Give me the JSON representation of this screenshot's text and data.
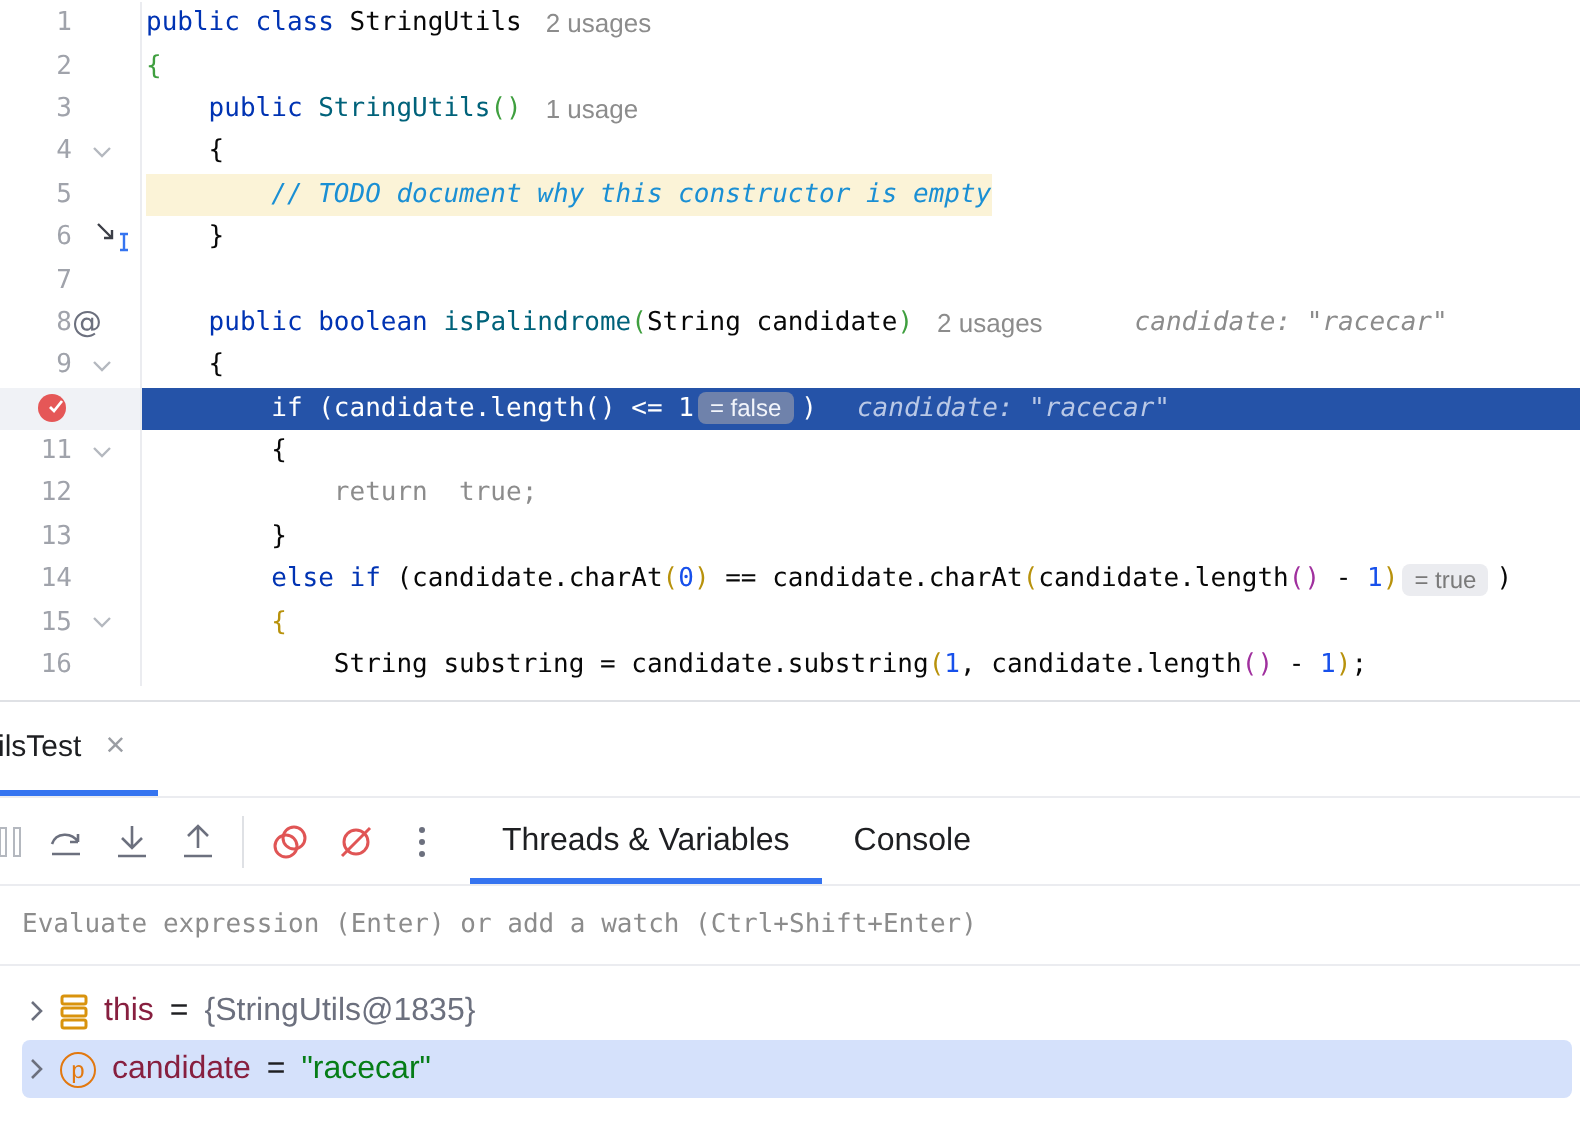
{
  "editor": {
    "lines": [
      {
        "number": "1",
        "foldable": false,
        "current": false,
        "breakpoint": false,
        "step_cursor": false,
        "tokens": [
          {
            "kind": "keyword",
            "text": "public class "
          },
          {
            "kind": "plain",
            "text": "StringUtils"
          },
          {
            "kind": "hint",
            "text": "2 usages"
          }
        ]
      },
      {
        "number": "2",
        "foldable": false,
        "current": false,
        "breakpoint": false,
        "step_cursor": false,
        "tokens": [
          {
            "kind": "green",
            "text": "{"
          }
        ]
      },
      {
        "number": "3",
        "foldable": false,
        "current": false,
        "breakpoint": false,
        "step_cursor": false,
        "tokens": [
          {
            "kind": "keyword",
            "text": "    public "
          },
          {
            "kind": "method",
            "text": "StringUtils"
          },
          {
            "kind": "green",
            "text": "()"
          },
          {
            "kind": "hint",
            "text": "1 usage"
          }
        ]
      },
      {
        "number": "4",
        "foldable": true,
        "current": false,
        "breakpoint": false,
        "step_cursor": false,
        "tokens": [
          {
            "kind": "plain",
            "text": "    {"
          }
        ]
      },
      {
        "number": "5",
        "foldable": false,
        "current": false,
        "breakpoint": false,
        "step_cursor": false,
        "tokens": [
          {
            "kind": "todo",
            "text": "        // TODO document why this constructor is empty"
          }
        ]
      },
      {
        "number": "6",
        "foldable": false,
        "current": false,
        "breakpoint": false,
        "step_cursor": true,
        "tokens": [
          {
            "kind": "plain",
            "text": "    }"
          }
        ]
      },
      {
        "number": "7",
        "foldable": false,
        "current": false,
        "breakpoint": false,
        "step_cursor": false
      },
      {
        "number": "8",
        "foldable": false,
        "current": false,
        "breakpoint": false,
        "step_cursor": false,
        "gutter_text": "@",
        "tokens": [
          {
            "kind": "keyword",
            "text": "    public boolean "
          },
          {
            "kind": "method",
            "text": "isPalindrome"
          },
          {
            "kind": "green",
            "text": "("
          },
          {
            "kind": "plain",
            "text": "String candidate"
          },
          {
            "kind": "green",
            "text": ")"
          },
          {
            "kind": "hint",
            "text": "2 usages"
          },
          {
            "kind": "inline_value",
            "text": "candidate: \"racecar\""
          }
        ]
      },
      {
        "number": "9",
        "foldable": true,
        "current": false,
        "breakpoint": false,
        "step_cursor": false,
        "tokens": [
          {
            "kind": "plain",
            "text": "    {"
          }
        ]
      },
      {
        "foldable": false,
        "current": true,
        "breakpoint": true,
        "step_cursor": false,
        "tokens": [
          {
            "kind": "keyword",
            "text": "        if "
          },
          {
            "kind": "plain",
            "text": "(candidate.length() <= "
          },
          {
            "kind": "number",
            "text": "1"
          },
          {
            "kind": "value_badge",
            "text": "= false"
          },
          {
            "kind": "plain",
            "text": ")"
          },
          {
            "kind": "inline_value",
            "text": "candidate: \"racecar\""
          }
        ]
      },
      {
        "number": "11",
        "foldable": true,
        "current": false,
        "breakpoint": false,
        "step_cursor": false,
        "tokens": [
          {
            "kind": "plain",
            "text": "        {"
          }
        ]
      },
      {
        "number": "12",
        "foldable": false,
        "current": false,
        "breakpoint": false,
        "step_cursor": false,
        "tokens": [
          {
            "kind": "muted",
            "text": "            return  true;"
          }
        ]
      },
      {
        "number": "13",
        "foldable": false,
        "current": false,
        "breakpoint": false,
        "step_cursor": false,
        "tokens": [
          {
            "kind": "plain",
            "text": "        }"
          }
        ]
      },
      {
        "number": "14",
        "foldable": false,
        "current": false,
        "breakpoint": false,
        "step_cursor": false,
        "tokens": [
          {
            "kind": "keyword",
            "text": "        else if "
          },
          {
            "kind": "plain",
            "text": "(candidate.charAt"
          },
          {
            "kind": "yellow",
            "text": "("
          },
          {
            "kind": "number",
            "text": "0"
          },
          {
            "kind": "yellow",
            "text": ")"
          },
          {
            "kind": "plain",
            "text": " == candidate.charAt"
          },
          {
            "kind": "yellow",
            "text": "("
          },
          {
            "kind": "plain",
            "text": "candidate.length"
          },
          {
            "kind": "purple",
            "text": "()"
          },
          {
            "kind": "plain",
            "text": " - "
          },
          {
            "kind": "number",
            "text": "1"
          },
          {
            "kind": "yellow",
            "text": ")"
          },
          {
            "kind": "value_badge",
            "text": "= true"
          },
          {
            "kind": "plain",
            "text": ")"
          }
        ]
      },
      {
        "number": "15",
        "foldable": true,
        "current": false,
        "breakpoint": false,
        "step_cursor": false,
        "tokens": [
          {
            "kind": "yellow",
            "text": "        {"
          }
        ]
      },
      {
        "number": "16",
        "foldable": false,
        "current": false,
        "breakpoint": false,
        "step_cursor": false,
        "tokens": [
          {
            "kind": "plain",
            "text": "            String substring = candidate.substring"
          },
          {
            "kind": "yellow",
            "text": "("
          },
          {
            "kind": "number",
            "text": "1"
          },
          {
            "kind": "plain",
            "text": ", candidate.length"
          },
          {
            "kind": "purple",
            "text": "()"
          },
          {
            "kind": "plain",
            "text": " - "
          },
          {
            "kind": "number",
            "text": "1"
          },
          {
            "kind": "yellow",
            "text": ")"
          },
          {
            "kind": "plain",
            "text": ";"
          }
        ]
      }
    ]
  },
  "session_tabs": [
    {
      "label": "ilsTest",
      "selected": true,
      "close": "×"
    }
  ],
  "debugger_tabs": [
    {
      "label": "Threads & Variables",
      "selected": true
    },
    {
      "label": "Console",
      "selected": false
    }
  ],
  "evaluate": {
    "placeholder": "Evaluate expression (Enter) or add a watch (Ctrl+Shift+Enter)"
  },
  "variables": [
    {
      "kind": "object",
      "name": "this",
      "equals": "=",
      "value": "{StringUtils@1835}",
      "selected": false
    },
    {
      "kind": "parameter",
      "badge": "p",
      "name": "candidate",
      "equals": "=",
      "value": "\"racecar\"",
      "selected": true
    }
  ]
}
